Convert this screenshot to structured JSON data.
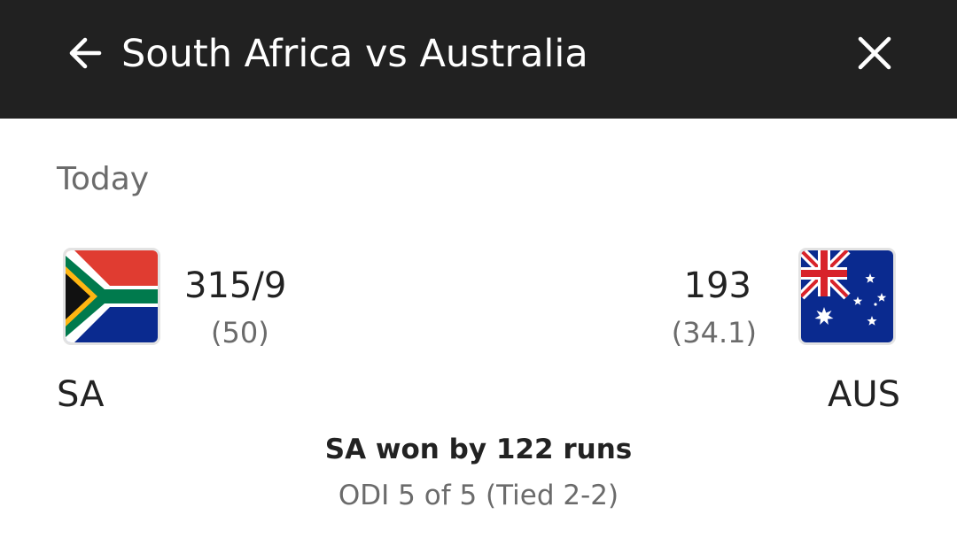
{
  "header": {
    "title": "South Africa vs Australia"
  },
  "match": {
    "date_label": "Today",
    "result": "SA won by 122 runs",
    "series": "ODI 5 of 5 (Tied 2-2)"
  },
  "teams": {
    "home": {
      "abbr": "SA",
      "score": "315/9",
      "overs": "(50)",
      "flag_icon": "south-africa-flag"
    },
    "away": {
      "abbr": "AUS",
      "score": "193",
      "overs": "(34.1)",
      "flag_icon": "australia-flag"
    }
  },
  "icons": {
    "back": "arrow-left-icon",
    "close": "close-icon"
  },
  "colors": {
    "header_bg": "#212121",
    "header_text": "#ffffff",
    "primary_text": "#222222",
    "secondary_text": "#6b6b6b"
  }
}
